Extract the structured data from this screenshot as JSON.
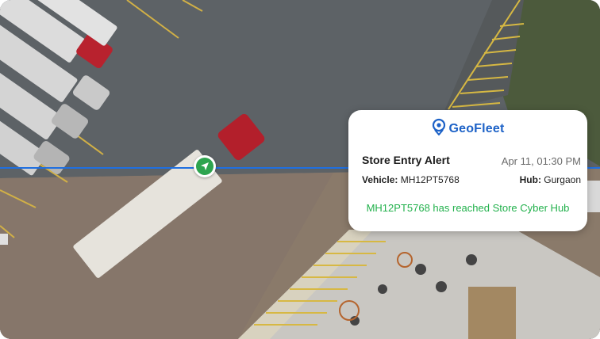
{
  "alert_card": {
    "brand": "GeoFleet",
    "title": "Store Entry Alert",
    "timestamp": "Apr 11, 01:30 PM",
    "vehicle_label": "Vehicle:",
    "vehicle_value": "MH12PT5768",
    "hub_label": "Hub:",
    "hub_value": "Gurgaon",
    "message": "MH12PT5768 has reached Store Cyber Hub"
  },
  "icons": {
    "brand_logo": "location-pin-icon",
    "vehicle_marker": "navigation-arrow-icon"
  },
  "colors": {
    "brand": "#1d62c7",
    "geofence_line": "#1f6fe0",
    "marker": "#2ea44f",
    "message": "#22b14c"
  }
}
